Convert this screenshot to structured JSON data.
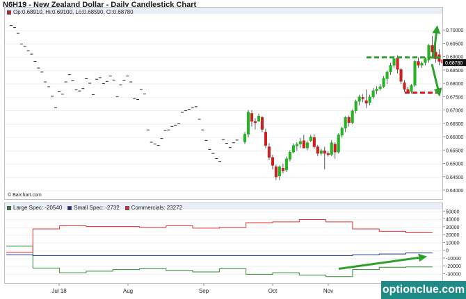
{
  "header": {
    "title": "N6H19 - New Zealand Dollar - Daily Candlestick Chart"
  },
  "price_panel": {
    "ohlc_text": "Op:0.68910, Hi:0.69100, Lo:0.68590, Cl:0.68780",
    "last_price_label": "0.68780",
    "credit": "© Barchart.com",
    "colors": {
      "up": "#22b422",
      "down": "#cc1f1f",
      "dash_cross": "#222222",
      "resistance": "#2ca02c",
      "support": "#d62020",
      "arrow": "#2ca02c"
    }
  },
  "cot_panel": {
    "legend": [
      {
        "label": "Large Spec: -20540",
        "color": "#2e8b2e"
      },
      {
        "label": "Small Spec: -2732",
        "color": "#1f2e8c"
      },
      {
        "label": "Commercials: 23272",
        "color": "#e03030"
      }
    ]
  },
  "x_axis": {
    "month_labels": [
      "Jul 18",
      "Aug",
      "Sep",
      "Oct",
      "Nov"
    ]
  },
  "watermark": "optionclue.com",
  "chart_data": [
    {
      "type": "candlestick",
      "title": "N6H19 - New Zealand Dollar - Daily Candlestick Chart",
      "ylim": [
        0.64,
        0.705
      ],
      "ytick_labels": [
        "0.64000",
        "0.64500",
        "0.65000",
        "0.65500",
        "0.66000",
        "0.66500",
        "0.67000",
        "0.67500",
        "0.68000",
        "0.68500",
        "0.69000",
        "0.69500",
        "0.70000"
      ],
      "yticks": [
        0.64,
        0.645,
        0.65,
        0.655,
        0.66,
        0.665,
        0.67,
        0.675,
        0.68,
        0.685,
        0.69,
        0.695,
        0.7
      ],
      "last_value": 0.6878,
      "resistance_level": 0.69,
      "support_level": 0.6768,
      "dash_bars": [
        0.702,
        0.7012,
        0.699,
        0.695,
        0.6942,
        0.6925,
        0.6912,
        0.6885,
        0.686,
        0.6845,
        0.6808,
        0.679,
        0.6755,
        0.6712,
        0.6773,
        0.6762,
        0.6808,
        0.6835,
        0.6812,
        0.6778,
        0.6774,
        0.6783,
        0.682,
        0.6803,
        0.676,
        0.6818,
        0.6824,
        0.6802,
        0.681,
        0.683,
        0.6815,
        0.6753,
        0.6797,
        0.6813,
        0.683,
        0.6808,
        0.6745,
        0.6742,
        0.678,
        0.6763,
        0.6628,
        0.6582,
        0.6575,
        0.657,
        0.6596,
        0.6626,
        0.6628,
        0.6641,
        0.6646,
        0.6651,
        0.6694,
        0.67,
        0.6705,
        0.6711,
        0.6715,
        0.6668,
        0.6628,
        0.6589,
        0.6555,
        0.654,
        0.6521,
        0.651,
        0.6592,
        0.6578,
        0.6562,
        0.658,
        0.659
      ],
      "candles": [
        [
          0.6583,
          0.662,
          0.6575,
          0.6612
        ],
        [
          0.6612,
          0.6703,
          0.66,
          0.6695
        ],
        [
          0.669,
          0.6702,
          0.664,
          0.666
        ],
        [
          0.666,
          0.6672,
          0.663,
          0.6655
        ],
        [
          0.666,
          0.669,
          0.6665,
          0.668
        ],
        [
          0.6675,
          0.668,
          0.662,
          0.663
        ],
        [
          0.662,
          0.6632,
          0.656,
          0.657
        ],
        [
          0.6565,
          0.6578,
          0.6515,
          0.6525
        ],
        [
          0.6525,
          0.6535,
          0.648,
          0.6495
        ],
        [
          0.649,
          0.6498,
          0.644,
          0.6452
        ],
        [
          0.6455,
          0.6495,
          0.644,
          0.649
        ],
        [
          0.6485,
          0.6502,
          0.6465,
          0.6475
        ],
        [
          0.6478,
          0.6528,
          0.647,
          0.652
        ],
        [
          0.6518,
          0.6552,
          0.651,
          0.6545
        ],
        [
          0.6545,
          0.6578,
          0.654,
          0.657
        ],
        [
          0.6568,
          0.6582,
          0.655,
          0.6575
        ],
        [
          0.6575,
          0.6598,
          0.656,
          0.6585
        ],
        [
          0.6588,
          0.661,
          0.657,
          0.656
        ],
        [
          0.656,
          0.6588,
          0.6552,
          0.658
        ],
        [
          0.6588,
          0.661,
          0.6582,
          0.6602
        ],
        [
          0.66,
          0.6612,
          0.6558,
          0.6565
        ],
        [
          0.6565,
          0.6572,
          0.653,
          0.654
        ],
        [
          0.654,
          0.6558,
          0.6532,
          0.655
        ],
        [
          0.655,
          0.6565,
          0.648,
          0.654
        ],
        [
          0.654,
          0.6548,
          0.6528,
          0.6535
        ],
        [
          0.6535,
          0.659,
          0.653,
          0.658
        ],
        [
          0.6575,
          0.6582,
          0.652,
          0.6545
        ],
        [
          0.6545,
          0.6615,
          0.654,
          0.661
        ],
        [
          0.6608,
          0.664,
          0.66,
          0.6635
        ],
        [
          0.6635,
          0.668,
          0.662,
          0.6675
        ],
        [
          0.6675,
          0.6682,
          0.664,
          0.6655
        ],
        [
          0.6655,
          0.6705,
          0.665,
          0.67
        ],
        [
          0.67,
          0.6742,
          0.669,
          0.6735
        ],
        [
          0.6735,
          0.676,
          0.672,
          0.6752
        ],
        [
          0.675,
          0.6762,
          0.6732,
          0.6745
        ],
        [
          0.6738,
          0.678,
          0.671,
          0.6728
        ],
        [
          0.673,
          0.676,
          0.672,
          0.6752
        ],
        [
          0.6752,
          0.6785,
          0.6745,
          0.6775
        ],
        [
          0.6775,
          0.6792,
          0.6762,
          0.6782
        ],
        [
          0.6782,
          0.68,
          0.6775,
          0.679
        ],
        [
          0.679,
          0.683,
          0.6785,
          0.6822
        ],
        [
          0.682,
          0.685,
          0.68,
          0.6845
        ],
        [
          0.6845,
          0.688,
          0.6835,
          0.687
        ],
        [
          0.687,
          0.6905,
          0.686,
          0.6895
        ],
        [
          0.6898,
          0.6908,
          0.684,
          0.6855
        ],
        [
          0.6855,
          0.686,
          0.68,
          0.681
        ],
        [
          0.6805,
          0.6815,
          0.677,
          0.678
        ],
        [
          0.678,
          0.679,
          0.6765,
          0.6772
        ],
        [
          0.6772,
          0.68,
          0.6765,
          0.6795
        ],
        [
          0.6795,
          0.689,
          0.679,
          0.6885
        ],
        [
          0.6885,
          0.69,
          0.686,
          0.687
        ],
        [
          0.687,
          0.6885,
          0.686,
          0.6878
        ],
        [
          0.688,
          0.69,
          0.687,
          0.6895
        ],
        [
          0.689,
          0.695,
          0.688,
          0.6945
        ],
        [
          0.6945,
          0.698,
          0.69,
          0.692
        ],
        [
          0.692,
          0.695,
          0.688,
          0.6895
        ],
        [
          0.691,
          0.693,
          0.687,
          0.6885
        ],
        [
          0.6891,
          0.691,
          0.6859,
          0.6878
        ]
      ]
    },
    {
      "type": "line",
      "title": "Commitment of Traders",
      "ylim": [
        -35000,
        52000
      ],
      "ytick_labels": [
        "50000",
        "40000",
        "30000",
        "20000",
        "10000",
        "0",
        "-10000",
        "-20000",
        "-30000"
      ],
      "yticks": [
        50000,
        40000,
        30000,
        20000,
        10000,
        0,
        -10000,
        -20000,
        -30000
      ],
      "weekly_points": 16,
      "series": [
        {
          "name": "Large Spec: -20540",
          "values": [
            6000,
            -22000,
            -28000,
            -26000,
            -24000,
            -23000,
            -25000,
            -27000,
            -23000,
            -30000,
            -28000,
            -31000,
            -33000,
            -24000,
            -21000,
            -20540
          ]
        },
        {
          "name": "Small Spec: -2732",
          "values": [
            -5000,
            -6000,
            -6000,
            -6000,
            -6000,
            -6000,
            -6000,
            -6000,
            -6000,
            -6000,
            -6000,
            -6000,
            -6000,
            -5000,
            -4000,
            -2732
          ]
        },
        {
          "name": "Commercials: 23272",
          "values": [
            -2000,
            28000,
            32000,
            31000,
            31000,
            30000,
            32000,
            29000,
            30000,
            36000,
            37000,
            40000,
            37000,
            28000,
            25000,
            23272
          ]
        }
      ]
    }
  ]
}
